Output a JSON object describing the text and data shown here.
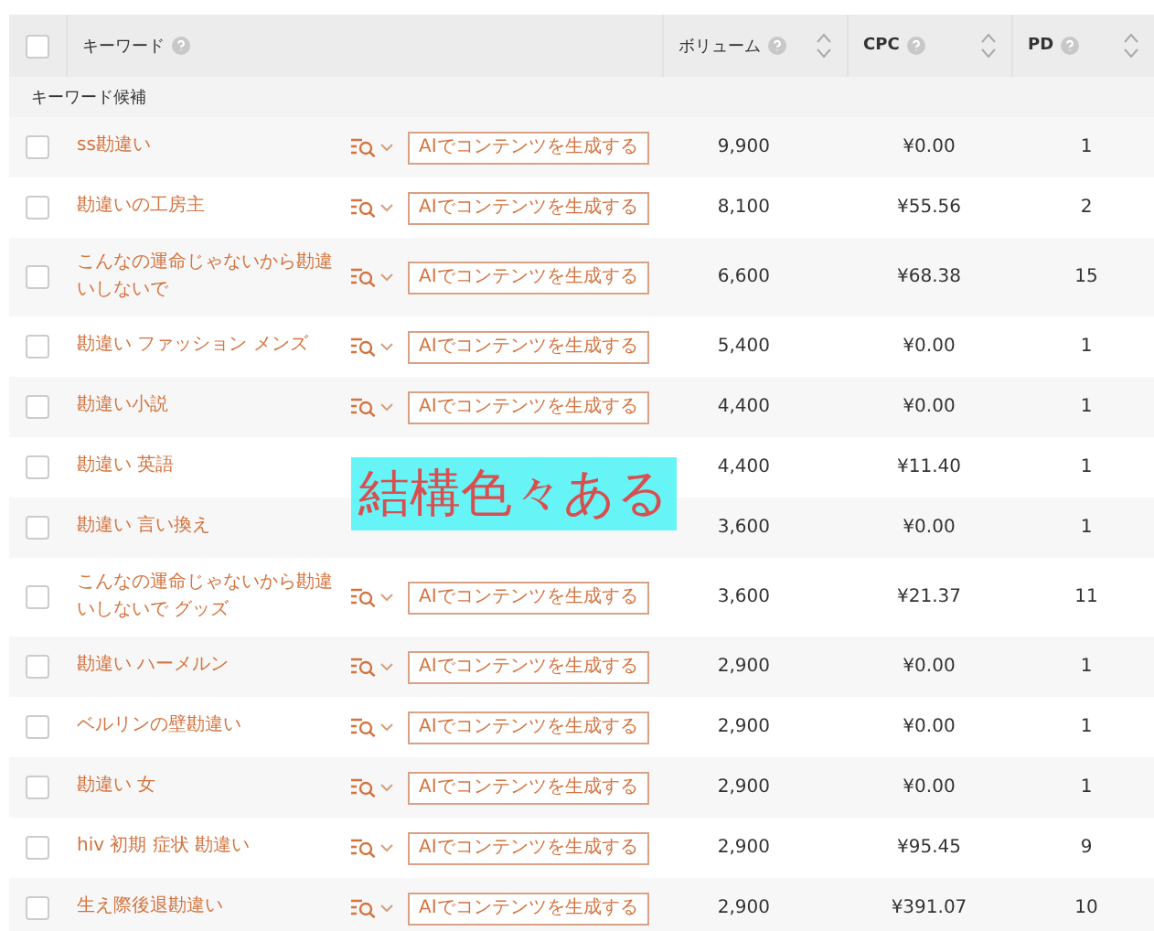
{
  "header": {
    "checked": false,
    "columns": [
      {
        "label": "キーワード",
        "kind": "text",
        "sortable": false
      },
      {
        "label": "ボリューム",
        "kind": "text",
        "sortable": true
      },
      {
        "label": "CPC",
        "kind": "bold",
        "sortable": true
      },
      {
        "label": "PD",
        "kind": "bold",
        "sortable": true
      }
    ]
  },
  "group": "キーワード候補",
  "rows": [
    {
      "checked": false,
      "keyword": "ss勘違い",
      "ai_button": "AIでコンテンツを生成する",
      "volume": "9,900",
      "cpc": "¥0.00",
      "pd": "1"
    },
    {
      "checked": false,
      "keyword": "勘違いの工房主",
      "ai_button": "AIでコンテンツを生成する",
      "volume": "8,100",
      "cpc": "¥55.56",
      "pd": "2"
    },
    {
      "checked": false,
      "keyword": "こんなの運命じゃないから勘違いしないで",
      "ai_button": "AIでコンテンツを生成する",
      "volume": "6,600",
      "cpc": "¥68.38",
      "pd": "15"
    },
    {
      "checked": false,
      "keyword": "勘違い ファッション メンズ",
      "ai_button": "AIでコンテンツを生成する",
      "volume": "5,400",
      "cpc": "¥0.00",
      "pd": "1"
    },
    {
      "checked": false,
      "keyword": "勘違い小説",
      "ai_button": "AIでコンテンツを生成する",
      "volume": "4,400",
      "cpc": "¥0.00",
      "pd": "1"
    },
    {
      "checked": false,
      "keyword": "勘違い 英語",
      "volume": "4,400",
      "cpc": "¥11.40",
      "pd": "1"
    },
    {
      "checked": false,
      "keyword": "勘違い 言い換え",
      "volume": "3,600",
      "cpc": "¥0.00",
      "pd": "1"
    },
    {
      "checked": false,
      "keyword": "こんなの運命じゃないから勘違いしないで グッズ",
      "ai_button": "AIでコンテンツを生成する",
      "volume": "3,600",
      "cpc": "¥21.37",
      "pd": "11"
    },
    {
      "checked": false,
      "keyword": "勘違い ハーメルン",
      "ai_button": "AIでコンテンツを生成する",
      "volume": "2,900",
      "cpc": "¥0.00",
      "pd": "1"
    },
    {
      "checked": false,
      "keyword": "ベルリンの壁勘違い",
      "ai_button": "AIでコンテンツを生成する",
      "volume": "2,900",
      "cpc": "¥0.00",
      "pd": "1"
    },
    {
      "checked": false,
      "keyword": "勘違い 女",
      "ai_button": "AIでコンテンツを生成する",
      "volume": "2,900",
      "cpc": "¥0.00",
      "pd": "1"
    },
    {
      "checked": false,
      "keyword": "hiv 初期 症状 勘違い",
      "ai_button": "AIでコンテンツを生成する",
      "volume": "2,900",
      "cpc": "¥95.45",
      "pd": "9"
    },
    {
      "checked": false,
      "keyword": "生え際後退勘違い",
      "ai_button": "AIでコンテンツを生成する",
      "volume": "2,900",
      "cpc": "¥391.07",
      "pd": "10"
    }
  ],
  "annotation": {
    "text": "結構色々ある"
  }
}
